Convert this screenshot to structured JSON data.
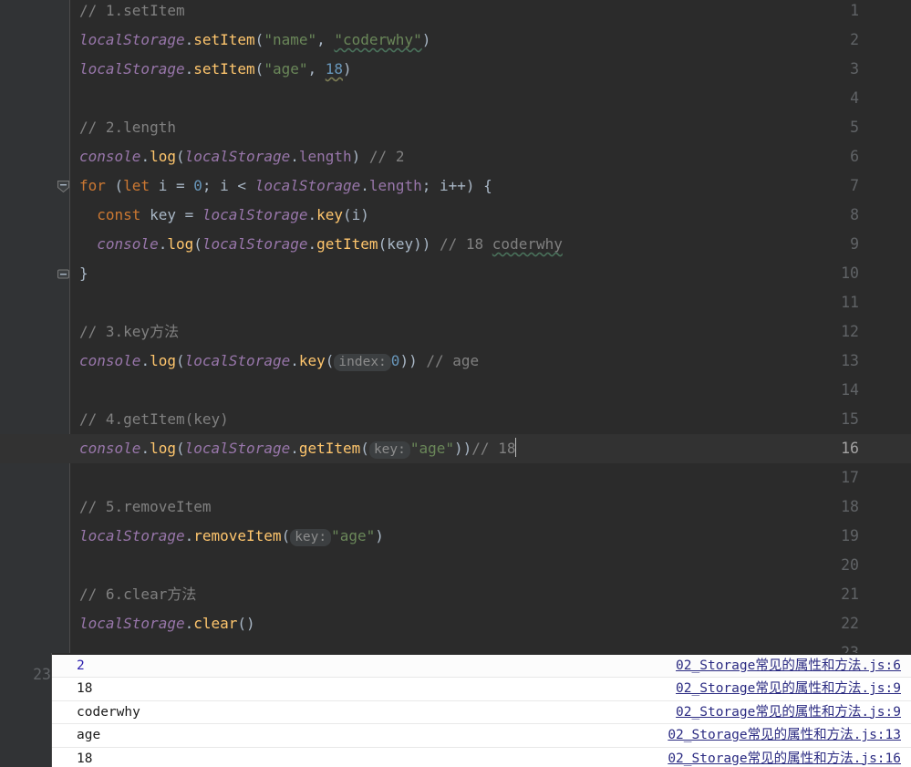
{
  "editor": {
    "language": "javascript",
    "theme": "darcula",
    "current_line": 16,
    "background": "#2B2B2B",
    "gutter_background": "#313335",
    "lines": [
      {
        "n": "1",
        "tokens": [
          {
            "t": "// 1.setItem",
            "c": "cm"
          }
        ]
      },
      {
        "n": "2",
        "tokens": [
          {
            "t": "localStorage",
            "c": "glob"
          },
          {
            "t": ".",
            "c": "pl"
          },
          {
            "t": "setItem",
            "c": "fn"
          },
          {
            "t": "(",
            "c": "pl"
          },
          {
            "t": "\"name\"",
            "c": "str"
          },
          {
            "t": ", ",
            "c": "pl"
          },
          {
            "t": "\"coderwhy\"",
            "c": "str spell"
          },
          {
            "t": ")",
            "c": "pl"
          }
        ]
      },
      {
        "n": "3",
        "tokens": [
          {
            "t": "localStorage",
            "c": "glob"
          },
          {
            "t": ".",
            "c": "pl"
          },
          {
            "t": "setItem",
            "c": "fn"
          },
          {
            "t": "(",
            "c": "pl"
          },
          {
            "t": "\"age\"",
            "c": "str"
          },
          {
            "t": ", ",
            "c": "pl"
          },
          {
            "t": "18",
            "c": "num spell-warn"
          },
          {
            "t": ")",
            "c": "pl"
          }
        ]
      },
      {
        "n": "4",
        "tokens": []
      },
      {
        "n": "5",
        "tokens": [
          {
            "t": "// 2.length",
            "c": "cm"
          }
        ]
      },
      {
        "n": "6",
        "tokens": [
          {
            "t": "console",
            "c": "glob"
          },
          {
            "t": ".",
            "c": "pl"
          },
          {
            "t": "log",
            "c": "fn"
          },
          {
            "t": "(",
            "c": "pl"
          },
          {
            "t": "localStorage",
            "c": "glob"
          },
          {
            "t": ".",
            "c": "pl"
          },
          {
            "t": "length",
            "c": "prop"
          },
          {
            "t": ") ",
            "c": "pl"
          },
          {
            "t": "// 2",
            "c": "cm"
          }
        ]
      },
      {
        "n": "7",
        "tokens": [
          {
            "t": "for",
            "c": "kw"
          },
          {
            "t": " (",
            "c": "pl"
          },
          {
            "t": "let",
            "c": "kw"
          },
          {
            "t": " i = ",
            "c": "pl"
          },
          {
            "t": "0",
            "c": "num"
          },
          {
            "t": "; i < ",
            "c": "pl"
          },
          {
            "t": "localStorage",
            "c": "glob"
          },
          {
            "t": ".",
            "c": "pl"
          },
          {
            "t": "length",
            "c": "prop"
          },
          {
            "t": "; i++) {",
            "c": "pl"
          }
        ]
      },
      {
        "n": "8",
        "tokens": [
          {
            "t": "  ",
            "c": "pl"
          },
          {
            "t": "const",
            "c": "kw"
          },
          {
            "t": " key = ",
            "c": "pl"
          },
          {
            "t": "localStorage",
            "c": "glob"
          },
          {
            "t": ".",
            "c": "pl"
          },
          {
            "t": "key",
            "c": "fn"
          },
          {
            "t": "(i)",
            "c": "pl"
          }
        ]
      },
      {
        "n": "9",
        "tokens": [
          {
            "t": "  ",
            "c": "pl"
          },
          {
            "t": "console",
            "c": "glob"
          },
          {
            "t": ".",
            "c": "pl"
          },
          {
            "t": "log",
            "c": "fn"
          },
          {
            "t": "(",
            "c": "pl"
          },
          {
            "t": "localStorage",
            "c": "glob"
          },
          {
            "t": ".",
            "c": "pl"
          },
          {
            "t": "getItem",
            "c": "fn"
          },
          {
            "t": "(key)) ",
            "c": "pl"
          },
          {
            "t": "// 18 ",
            "c": "cm"
          },
          {
            "t": "coderwhy",
            "c": "cm spell"
          }
        ]
      },
      {
        "n": "10",
        "tokens": [
          {
            "t": "}",
            "c": "pl"
          }
        ]
      },
      {
        "n": "11",
        "tokens": []
      },
      {
        "n": "12",
        "tokens": [
          {
            "t": "// 3.key方法",
            "c": "cm"
          }
        ]
      },
      {
        "n": "13",
        "tokens": [
          {
            "t": "console",
            "c": "glob"
          },
          {
            "t": ".",
            "c": "pl"
          },
          {
            "t": "log",
            "c": "fn"
          },
          {
            "t": "(",
            "c": "pl"
          },
          {
            "t": "localStorage",
            "c": "glob"
          },
          {
            "t": ".",
            "c": "pl"
          },
          {
            "t": "key",
            "c": "fn"
          },
          {
            "t": "(",
            "c": "pl"
          },
          {
            "t": "index:",
            "c": "hint"
          },
          {
            "t": "0",
            "c": "num"
          },
          {
            "t": ")) ",
            "c": "pl"
          },
          {
            "t": "// age",
            "c": "cm"
          }
        ]
      },
      {
        "n": "14",
        "tokens": []
      },
      {
        "n": "15",
        "tokens": [
          {
            "t": "// 4.getItem(key)",
            "c": "cm"
          }
        ]
      },
      {
        "n": "16",
        "tokens": [
          {
            "t": "console",
            "c": "glob"
          },
          {
            "t": ".",
            "c": "pl"
          },
          {
            "t": "log",
            "c": "fn"
          },
          {
            "t": "(",
            "c": "pl"
          },
          {
            "t": "localStorage",
            "c": "glob"
          },
          {
            "t": ".",
            "c": "pl"
          },
          {
            "t": "getItem",
            "c": "fn"
          },
          {
            "t": "(",
            "c": "pl"
          },
          {
            "t": "key:",
            "c": "hint"
          },
          {
            "t": "\"age\"",
            "c": "str"
          },
          {
            "t": "))",
            "c": "pl"
          },
          {
            "t": "// 18",
            "c": "cm"
          }
        ]
      },
      {
        "n": "17",
        "tokens": []
      },
      {
        "n": "18",
        "tokens": [
          {
            "t": "// 5.removeItem",
            "c": "cm"
          }
        ]
      },
      {
        "n": "19",
        "tokens": [
          {
            "t": "localStorage",
            "c": "glob"
          },
          {
            "t": ".",
            "c": "pl"
          },
          {
            "t": "removeItem",
            "c": "fn"
          },
          {
            "t": "(",
            "c": "pl"
          },
          {
            "t": "key:",
            "c": "hint"
          },
          {
            "t": "\"age\"",
            "c": "str"
          },
          {
            "t": ")",
            "c": "pl"
          }
        ]
      },
      {
        "n": "20",
        "tokens": []
      },
      {
        "n": "21",
        "tokens": [
          {
            "t": "// 6.clear方法",
            "c": "cm"
          }
        ]
      },
      {
        "n": "22",
        "tokens": [
          {
            "t": "localStorage",
            "c": "glob"
          },
          {
            "t": ".",
            "c": "pl"
          },
          {
            "t": "clear",
            "c": "fn"
          },
          {
            "t": "()",
            "c": "pl"
          }
        ]
      },
      {
        "n": "23",
        "tokens": []
      }
    ],
    "folding": [
      {
        "line": "7",
        "state": "expanded"
      },
      {
        "line": "10",
        "state": "end"
      }
    ]
  },
  "console": {
    "background": "#FFFFFF",
    "link_color": "#2B2B82",
    "rows": [
      {
        "message": "2",
        "source": "02_Storage常见的属性和方法.js:6",
        "message_is_link": true
      },
      {
        "message": "18",
        "source": "02_Storage常见的属性和方法.js:9",
        "message_is_link": false
      },
      {
        "message": "coderwhy",
        "source": "02_Storage常见的属性和方法.js:9",
        "message_is_link": false
      },
      {
        "message": "age",
        "source": "02_Storage常见的属性和方法.js:13",
        "message_is_link": false
      },
      {
        "message": "18",
        "source": "02_Storage常见的属性和方法.js:16",
        "message_is_link": false
      }
    ]
  }
}
